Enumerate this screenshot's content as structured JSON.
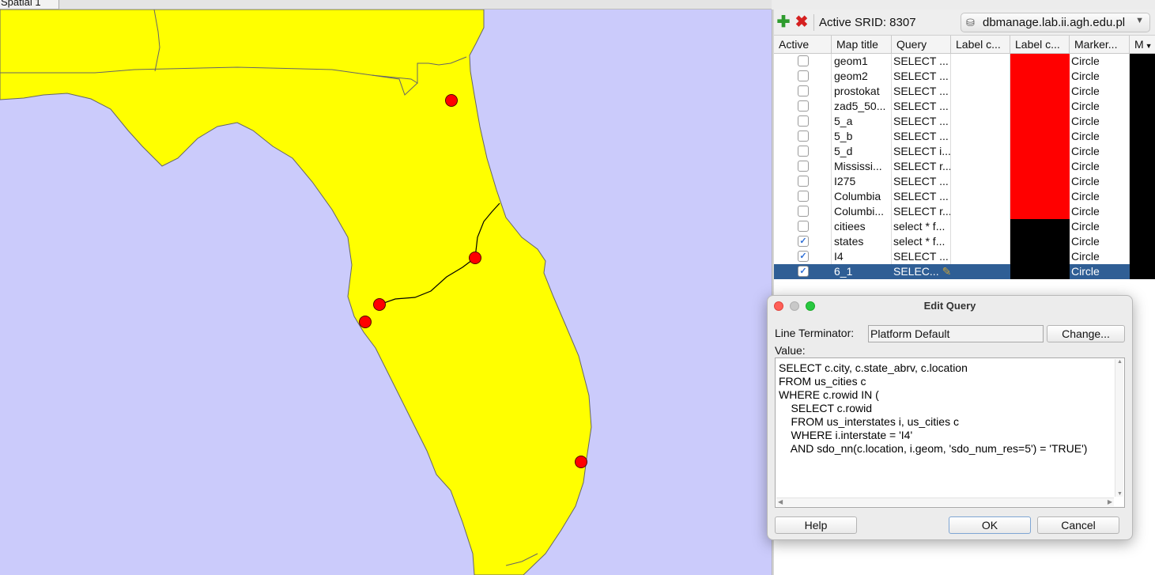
{
  "tab": {
    "label": "Spatial 1"
  },
  "map": {
    "ocean_color": "#cbcbfb",
    "land_color": "#ffff00",
    "border_color": "#666666",
    "marker_color": "#ff0000",
    "markers": [
      "city-1",
      "city-2",
      "city-3",
      "city-4",
      "city-5"
    ]
  },
  "toolbar": {
    "add_icon": "plus-icon",
    "delete_icon": "x-icon",
    "srid_label": "Active SRID: 8307",
    "connection": "dbmanage.lab.ii.agh.edu.pl"
  },
  "table": {
    "columns": [
      "Active",
      "Map title",
      "Query",
      "Label c...",
      "Label c...",
      "Marker...",
      "M"
    ],
    "rows": [
      {
        "active": false,
        "title": "geom1",
        "query": "SELECT ...",
        "label_color": "#ff0000",
        "marker": "Circle"
      },
      {
        "active": false,
        "title": "geom2",
        "query": "SELECT ...",
        "label_color": "#ff0000",
        "marker": "Circle"
      },
      {
        "active": false,
        "title": "prostokat",
        "query": "SELECT  ...",
        "label_color": "#ff0000",
        "marker": "Circle"
      },
      {
        "active": false,
        "title": "zad5_50...",
        "query": "SELECT ...",
        "label_color": "#ff0000",
        "marker": "Circle"
      },
      {
        "active": false,
        "title": "5_a",
        "query": "SELECT ...",
        "label_color": "#ff0000",
        "marker": "Circle"
      },
      {
        "active": false,
        "title": "5_b",
        "query": "SELECT ...",
        "label_color": "#ff0000",
        "marker": "Circle"
      },
      {
        "active": false,
        "title": "5_d",
        "query": "SELECT i...",
        "label_color": "#ff0000",
        "marker": "Circle"
      },
      {
        "active": false,
        "title": "Mississi...",
        "query": "SELECT r...",
        "label_color": "#ff0000",
        "marker": "Circle"
      },
      {
        "active": false,
        "title": "I275",
        "query": "SELECT ...",
        "label_color": "#ff0000",
        "marker": "Circle"
      },
      {
        "active": false,
        "title": "Columbia",
        "query": "SELECT ...",
        "label_color": "#ff0000",
        "marker": "Circle"
      },
      {
        "active": false,
        "title": "Columbi...",
        "query": "SELECT r...",
        "label_color": "#ff0000",
        "marker": "Circle"
      },
      {
        "active": false,
        "title": "citiees",
        "query": "select * f...",
        "label_color": "#000000",
        "marker": "Circle"
      },
      {
        "active": true,
        "title": "states",
        "query": "select * f...",
        "label_color": "#000000",
        "marker": "Circle"
      },
      {
        "active": true,
        "title": "I4",
        "query": "SELECT ...",
        "label_color": "#000000",
        "marker": "Circle"
      },
      {
        "active": true,
        "title": "6_1",
        "query": "SELEC...",
        "label_color": "#000000",
        "marker": "Circle",
        "selected": true
      }
    ]
  },
  "dialog": {
    "title": "Edit Query",
    "line_terminator_label": "Line Terminator:",
    "line_terminator_value": "Platform Default",
    "change_button": "Change...",
    "value_label": "Value:",
    "query_lines": [
      "SELECT c.city, c.state_abrv, c.location",
      "FROM us_cities c",
      "WHERE c.rowid IN (",
      "    SELECT c.rowid",
      "    FROM us_interstates i, us_cities c",
      "    WHERE i.interstate = 'I4'",
      "    AND sdo_nn(c.location, i.geom, 'sdo_num_res=5') = 'TRUE')"
    ],
    "help_button": "Help",
    "ok_button": "OK",
    "cancel_button": "Cancel"
  }
}
